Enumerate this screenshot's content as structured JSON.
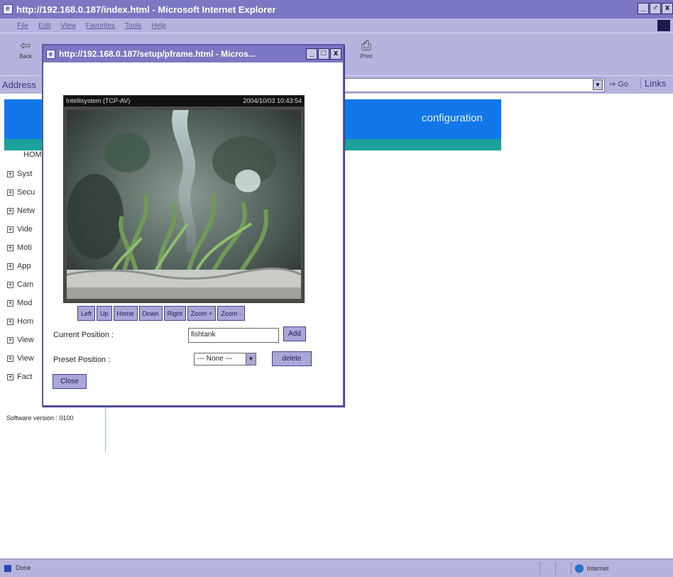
{
  "main_window": {
    "title": "http://192.168.0.187/index.html - Microsoft Internet Explorer",
    "controls": [
      "_",
      "♂",
      "x"
    ]
  },
  "menu": [
    "File",
    "Edit",
    "View",
    "Favorites",
    "Tools",
    "Help"
  ],
  "toolbar": {
    "back_label": "Back",
    "print_label": "Print"
  },
  "address_bar": {
    "label": "Address",
    "go_label": "Go",
    "links_label": "Links"
  },
  "page": {
    "banner_text": "configuration",
    "nav_home": "HOME",
    "nav_items": [
      "Syst",
      "Secu",
      "Netw",
      "Vide",
      "Moti",
      "App",
      "Cam",
      "Mod",
      "Hom",
      "View",
      "View",
      "Fact"
    ],
    "software_version": "Software version : 0100"
  },
  "popup": {
    "title": "http://192.168.0.187/setup/pframe.html - Micros...",
    "camera": {
      "caption_left": "Intellisystem (TCP-AV)",
      "caption_right": "2004/10/03 10:43:54"
    },
    "ptz_buttons": [
      "Left",
      "Up",
      "Home",
      "Down",
      "Right",
      "Zoom +",
      "Zoom -"
    ],
    "current_position_label": "Current Position :",
    "current_position_value": "fishtank",
    "add_label": "Add",
    "preset_position_label": "Preset Position :",
    "preset_selected": "--- None ---",
    "delete_label": "delete",
    "close_label": "Close"
  },
  "status_bar": {
    "text": "Done",
    "zone": "Internet"
  }
}
